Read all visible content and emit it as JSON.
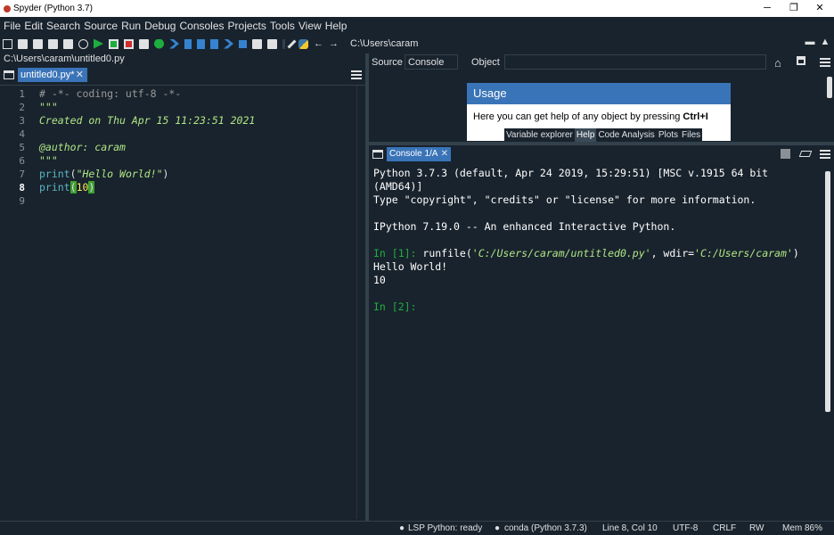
{
  "window": {
    "title": "Spyder (Python 3.7)",
    "controls": {
      "minimize": "─",
      "restore": "❐",
      "close": "✕"
    }
  },
  "menu": [
    "File",
    "Edit",
    "Search",
    "Source",
    "Run",
    "Debug",
    "Consoles",
    "Projects",
    "Tools",
    "View",
    "Help"
  ],
  "toolbar": {
    "path": "C:\\Users\\caram"
  },
  "editor": {
    "file_path": "C:\\Users\\caram\\untitled0.py",
    "tab_label": "untitled0.py*",
    "tab_close": "✕",
    "current_line": 8,
    "line_numbers": [
      "1",
      "2",
      "3",
      "4",
      "5",
      "6",
      "7",
      "8",
      "9"
    ],
    "lines": {
      "l1": "# -*- coding: utf-8 -*-",
      "l2": "\"\"\"",
      "l3": "Created on Thu Apr 15 11:23:51 2021",
      "l4": "",
      "l5": "@author: caram",
      "l6": "\"\"\"",
      "l7_fn": "print",
      "l7_open": "(",
      "l7_str": "\"Hello World!\"",
      "l7_close": ")",
      "l8_fn": "print",
      "l8_open": "(",
      "l8_num": "10",
      "l8_close": ")"
    }
  },
  "help": {
    "source_label": "Source",
    "console_label": "Console",
    "object_label": "Object",
    "usage_title": "Usage",
    "usage_text_line1": "Here you can get help of any object by pressing ",
    "usage_text_bold": "Ctrl+I",
    "tabs": [
      "Variable explorer",
      "Help",
      "Code Analysis",
      "Plots",
      "Files"
    ],
    "selected_tab": "Help"
  },
  "console": {
    "tab_label": "Console 1/A",
    "tab_close": "✕",
    "lines": {
      "c1": "Python 3.7.3 (default, Apr 24 2019, 15:29:51) [MSC v.1915 64 bit",
      "c2": "(AMD64)]",
      "c3": "Type \"copyright\", \"credits\" or \"license\" for more information.",
      "c4": "IPython 7.19.0 -- An enhanced Interactive Python.",
      "c5_prompt": "In [1]:",
      "c5_cmd": " runfile(",
      "c5_path": "'C:/Users/caram/untitled0.py'",
      "c5_mid": ", wdir=",
      "c5_wdir": "'C:/Users/caram'",
      "c5_end": ")",
      "c6": "Hello World!",
      "c7": "10",
      "c8_prompt": "In [2]:"
    }
  },
  "status": {
    "lsp": "LSP Python: ready",
    "conda": "conda (Python 3.7.3)",
    "position": "Line 8, Col 10",
    "encoding": "UTF-8",
    "eol": "CRLF",
    "permissions": "RW",
    "memory": "Mem 86%"
  },
  "colors": {
    "background": "#19232d",
    "tab_selected": "#3a74b8",
    "prompt": "#1eae3f",
    "string": "#b0e686",
    "number": "#faed5c"
  }
}
